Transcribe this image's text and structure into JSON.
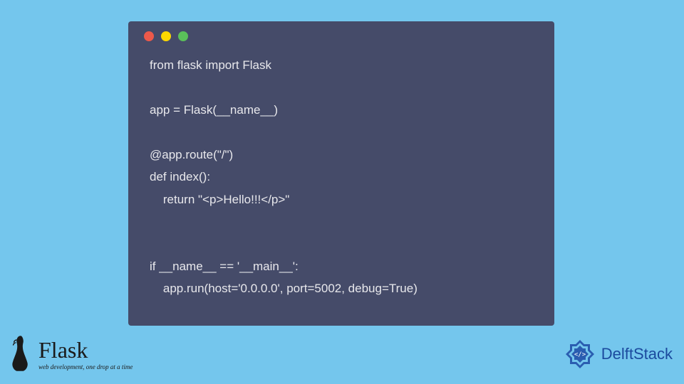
{
  "code": {
    "lines": "from flask import Flask\n\napp = Flask(__name__)\n\n@app.route(\"/\")\ndef index():\n    return \"<p>Hello!!!</p>\"\n\n\nif __name__ == '__main__':\n    app.run(host='0.0.0.0', port=5002, debug=True)"
  },
  "flask": {
    "title": "Flask",
    "subtitle": "web development,\none drop at a time"
  },
  "delft": {
    "text": "DelftStack"
  }
}
